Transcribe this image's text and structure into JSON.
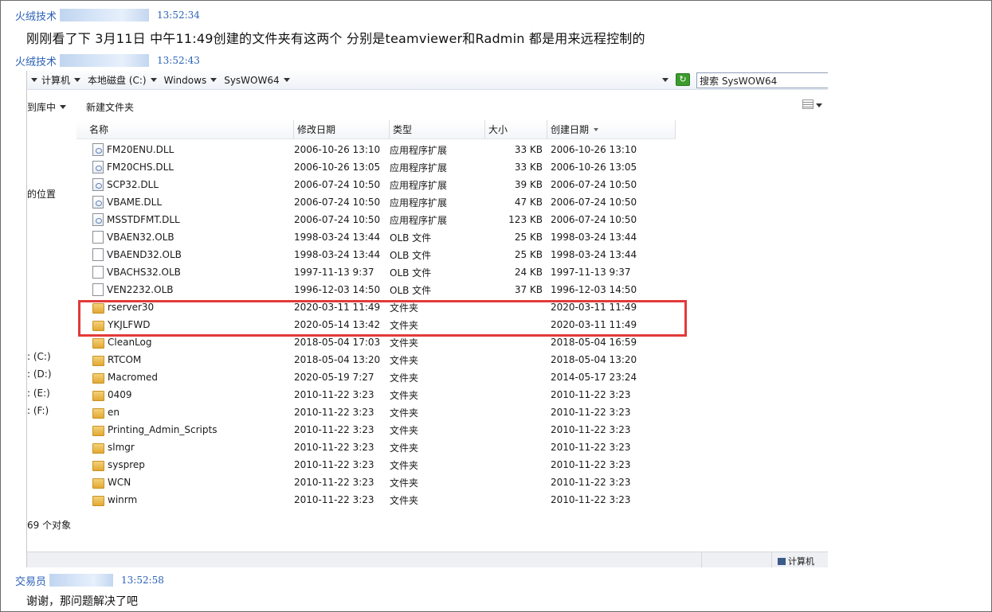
{
  "messages": [
    {
      "sender": "火绒技术",
      "time": "13:52:34",
      "text": "刚刚看了下 3月11日 中午11:49创建的文件夹有这两个 分别是teamviewer和Radmin 都是用来远程控制的"
    },
    {
      "sender": "火绒技术",
      "time": "13:52:43"
    },
    {
      "sender": "交易员",
      "time": "13:52:58",
      "text": "谢谢，那问题解决了吧"
    }
  ],
  "explorer": {
    "breadcrumbs": [
      "计算机",
      "本地磁盘 (C:)",
      "Windows",
      "SysWOW64"
    ],
    "search_placeholder": "搜索 SysWOW64",
    "toolbar": {
      "library_label": "到库中",
      "new_folder_label": "新建文件夹"
    },
    "nav": {
      "recent_label": "的位置",
      "drives": [
        ": (C:)",
        ": (D:)",
        ": (E:)",
        ": (F:)"
      ]
    },
    "columns": {
      "name": "名称",
      "modified": "修改日期",
      "type": "类型",
      "size": "大小",
      "created": "创建日期"
    },
    "files": [
      {
        "name": "FM20ENU.DLL",
        "modified": "2006-10-26 13:10",
        "type": "应用程序扩展",
        "size": "33 KB",
        "created": "2006-10-26 13:10",
        "icon": "dll-icon"
      },
      {
        "name": "FM20CHS.DLL",
        "modified": "2006-10-26 13:05",
        "type": "应用程序扩展",
        "size": "33 KB",
        "created": "2006-10-26 13:05",
        "icon": "dll-icon"
      },
      {
        "name": "SCP32.DLL",
        "modified": "2006-07-24 10:50",
        "type": "应用程序扩展",
        "size": "39 KB",
        "created": "2006-07-24 10:50",
        "icon": "dll-icon"
      },
      {
        "name": "VBAME.DLL",
        "modified": "2006-07-24 10:50",
        "type": "应用程序扩展",
        "size": "47 KB",
        "created": "2006-07-24 10:50",
        "icon": "dll-icon"
      },
      {
        "name": "MSSTDFMT.DLL",
        "modified": "2006-07-24 10:50",
        "type": "应用程序扩展",
        "size": "123 KB",
        "created": "2006-07-24 10:50",
        "icon": "dll-icon"
      },
      {
        "name": "VBAEN32.OLB",
        "modified": "1998-03-24 13:44",
        "type": "OLB 文件",
        "size": "25 KB",
        "created": "1998-03-24 13:44",
        "icon": "file-icon"
      },
      {
        "name": "VBAEND32.OLB",
        "modified": "1998-03-24 13:44",
        "type": "OLB 文件",
        "size": "25 KB",
        "created": "1998-03-24 13:44",
        "icon": "file-icon"
      },
      {
        "name": "VBACHS32.OLB",
        "modified": "1997-11-13 9:37",
        "type": "OLB 文件",
        "size": "24 KB",
        "created": "1997-11-13 9:37",
        "icon": "file-icon"
      },
      {
        "name": "VEN2232.OLB",
        "modified": "1996-12-03 14:50",
        "type": "OLB 文件",
        "size": "37 KB",
        "created": "1996-12-03 14:50",
        "icon": "file-icon"
      },
      {
        "name": "rserver30",
        "modified": "2020-03-11 11:49",
        "type": "文件夹",
        "size": "",
        "created": "2020-03-11 11:49",
        "icon": "folder-icon"
      },
      {
        "name": "YKJLFWD",
        "modified": "2020-05-14 13:42",
        "type": "文件夹",
        "size": "",
        "created": "2020-03-11 11:49",
        "icon": "folder-icon"
      },
      {
        "name": "CleanLog",
        "modified": "2018-05-04 17:03",
        "type": "文件夹",
        "size": "",
        "created": "2018-05-04 16:59",
        "icon": "folder-icon"
      },
      {
        "name": "RTCOM",
        "modified": "2018-05-04 13:20",
        "type": "文件夹",
        "size": "",
        "created": "2018-05-04 13:20",
        "icon": "folder-icon"
      },
      {
        "name": "Macromed",
        "modified": "2020-05-19 7:27",
        "type": "文件夹",
        "size": "",
        "created": "2014-05-17 23:24",
        "icon": "folder-icon"
      },
      {
        "name": "0409",
        "modified": "2010-11-22 3:23",
        "type": "文件夹",
        "size": "",
        "created": "2010-11-22 3:23",
        "icon": "folder-icon"
      },
      {
        "name": "en",
        "modified": "2010-11-22 3:23",
        "type": "文件夹",
        "size": "",
        "created": "2010-11-22 3:23",
        "icon": "folder-icon"
      },
      {
        "name": "Printing_Admin_Scripts",
        "modified": "2010-11-22 3:23",
        "type": "文件夹",
        "size": "",
        "created": "2010-11-22 3:23",
        "icon": "folder-icon"
      },
      {
        "name": "slmgr",
        "modified": "2010-11-22 3:23",
        "type": "文件夹",
        "size": "",
        "created": "2010-11-22 3:23",
        "icon": "folder-icon"
      },
      {
        "name": "sysprep",
        "modified": "2010-11-22 3:23",
        "type": "文件夹",
        "size": "",
        "created": "2010-11-22 3:23",
        "icon": "folder-icon"
      },
      {
        "name": "WCN",
        "modified": "2010-11-22 3:23",
        "type": "文件夹",
        "size": "",
        "created": "2010-11-22 3:23",
        "icon": "folder-icon"
      },
      {
        "name": "winrm",
        "modified": "2010-11-22 3:23",
        "type": "文件夹",
        "size": "",
        "created": "2010-11-22 3:23",
        "icon": "folder-icon"
      }
    ],
    "status_text": "69 个对象",
    "bottom_location": "计算机",
    "colors": {
      "highlight": "#e23a3a",
      "chat_name": "#2a61b6",
      "refresh_green": "#3b9c2c"
    }
  }
}
